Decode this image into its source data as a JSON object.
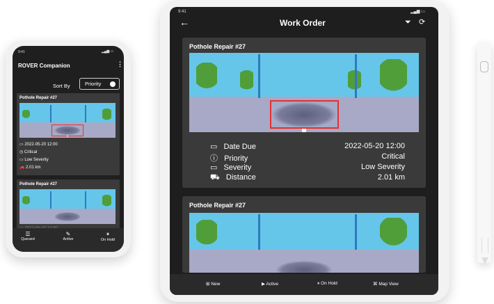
{
  "phone": {
    "status": {
      "time": "9:41"
    },
    "app_title": "ROVER Companion",
    "sort_by_label": "Sort By",
    "sort_value": "Priority",
    "card1": {
      "title": "Pothole Repair #27",
      "date": "2022-05-20 12:00",
      "priority": "Critical",
      "severity": "Low Severity",
      "distance": "2.01 km"
    },
    "card2": {
      "title": "Pothole Repair #27",
      "date_partial": "2022-05-20 12:00"
    },
    "nav": [
      "Queued",
      "Active",
      "On Hold"
    ]
  },
  "tablet": {
    "status": {
      "time": "9:41"
    },
    "title": "Work Order",
    "card1": {
      "title": "Pothole Repair #27",
      "rows": [
        {
          "label": "Date Due",
          "value": "2022-05-20 12:00"
        },
        {
          "label": "Priority",
          "value": "Critical"
        },
        {
          "label": "Severity",
          "value": "Low Severity"
        },
        {
          "label": "Distance",
          "value": "2.01 km"
        }
      ]
    },
    "card2": {
      "title": "Pothole Repair #27"
    },
    "nav": [
      "New",
      "Active",
      "On Hold",
      "Map View"
    ]
  },
  "icons": [
    "back-arrow-icon",
    "filter-icon",
    "refresh-icon",
    "kebab-menu-icon",
    "calendar-icon",
    "priority-icon",
    "severity-icon",
    "car-icon",
    "queue-icon",
    "wrench-icon",
    "hold-icon",
    "map-icon"
  ],
  "colors": {
    "highlight_red": "#e53030",
    "card_bg": "#3a3a3a",
    "screen_bg": "#1f1f1f",
    "sky": "#65c6ea"
  }
}
